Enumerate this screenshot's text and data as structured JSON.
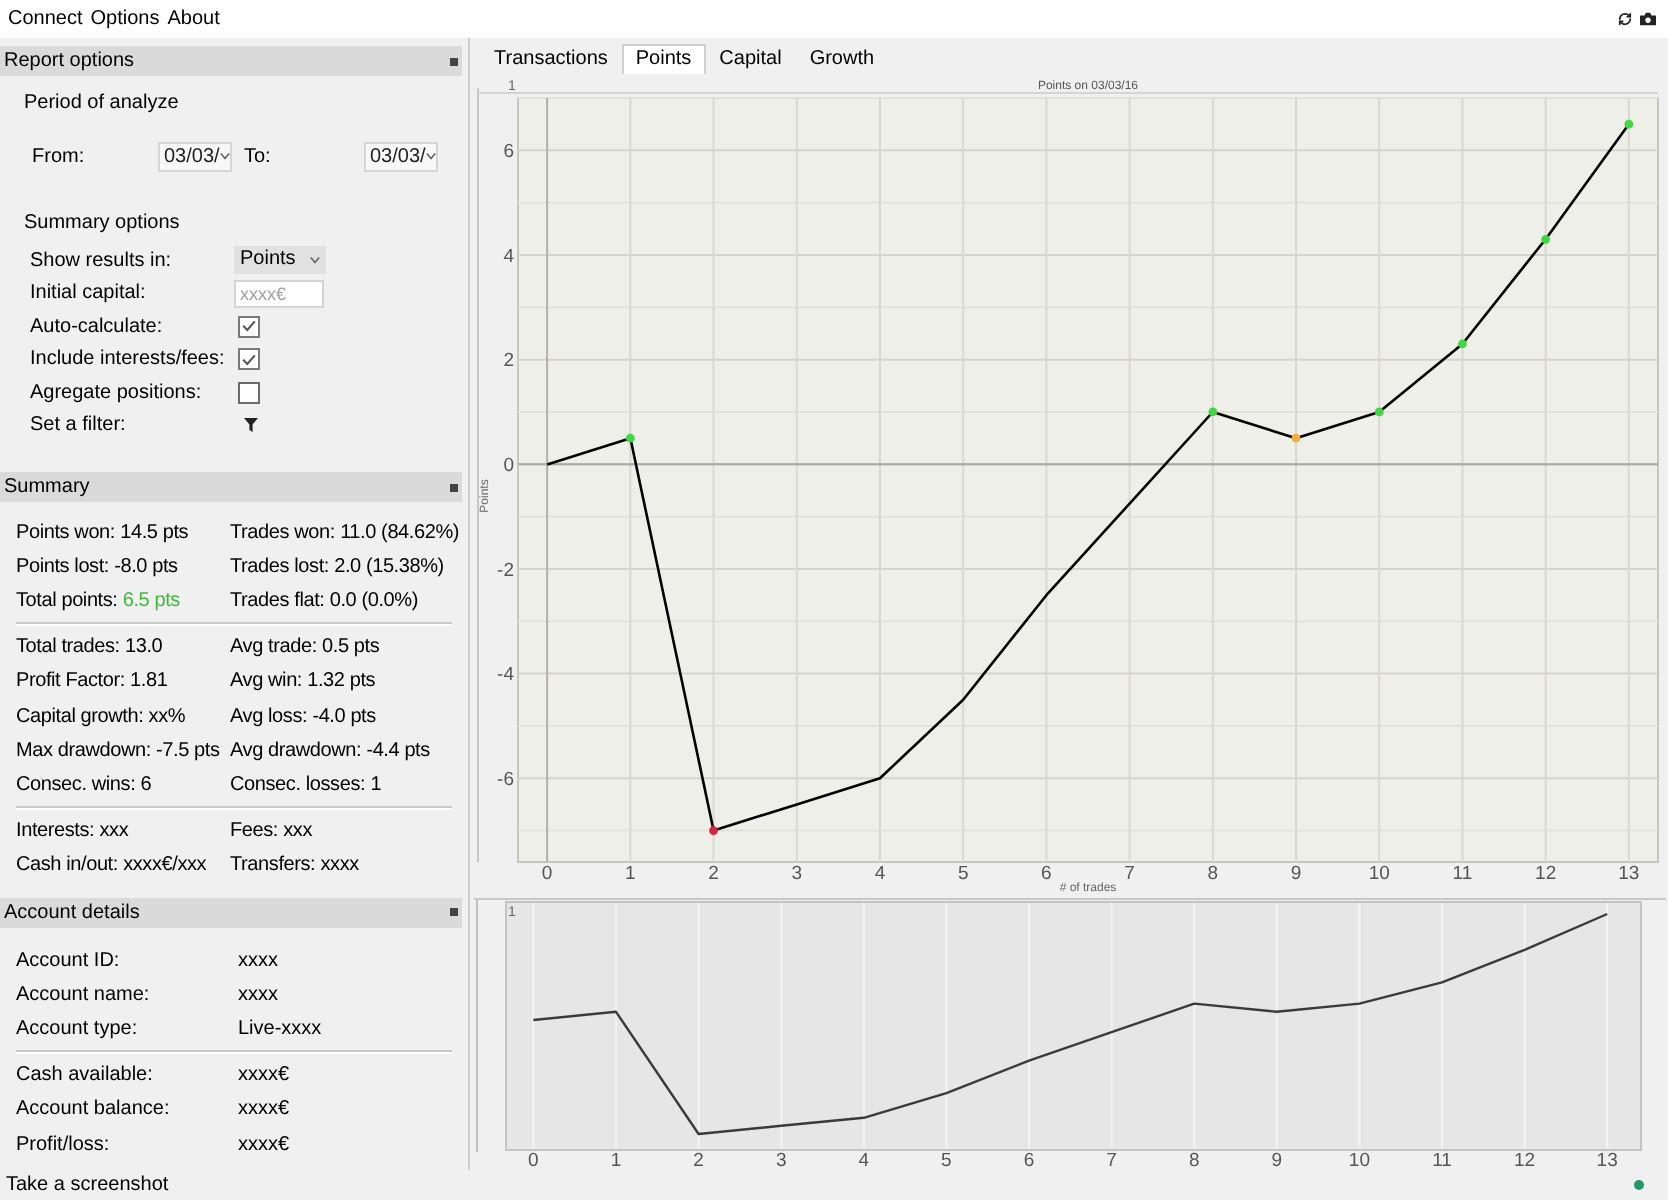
{
  "menu": [
    "Connect",
    "Options",
    "About"
  ],
  "report_options": {
    "title": "Report options",
    "period_heading": "Period of analyze",
    "from_label": "From:",
    "from_value": "03/03/",
    "to_label": "To:",
    "to_value": "03/03/",
    "summary_heading": "Summary options",
    "options": [
      {
        "kind": "select",
        "label": "Show results in:",
        "value": "Points"
      },
      {
        "kind": "input",
        "label": "Initial capital:",
        "placeholder": "xxxx€"
      },
      {
        "kind": "checkbox",
        "label": "Auto-calculate:",
        "checked": true
      },
      {
        "kind": "checkbox",
        "label": "Include interests/fees:",
        "checked": true
      },
      {
        "kind": "checkbox",
        "label": "Agregate positions:",
        "checked": false
      },
      {
        "kind": "filter",
        "label": "Set a filter:"
      }
    ]
  },
  "summary": {
    "title": "Summary",
    "groups": [
      [
        [
          {
            "label": "Points won:",
            "value": "14.5 pts"
          },
          {
            "label": "Trades won:",
            "value": "11.0 (84.62%)"
          }
        ],
        [
          {
            "label": "Points lost:",
            "value": "-8.0 pts"
          },
          {
            "label": "Trades lost:",
            "value": "2.0 (15.38%)"
          }
        ],
        [
          {
            "label": "Total points:",
            "value": "6.5 pts",
            "color": "#3dbb3d"
          },
          {
            "label": "Trades flat:",
            "value": "0.0 (0.0%)"
          }
        ]
      ],
      [
        [
          {
            "label": "Total trades:",
            "value": "13.0"
          },
          {
            "label": "Avg trade:",
            "value": "0.5 pts"
          }
        ],
        [
          {
            "label": "Profit Factor:",
            "value": "1.81"
          },
          {
            "label": "Avg win:",
            "value": "1.32 pts"
          }
        ],
        [
          {
            "label": "Capital growth:",
            "value": "xx%"
          },
          {
            "label": "Avg loss:",
            "value": "-4.0 pts"
          }
        ],
        [
          {
            "label": "Max drawdown:",
            "value": "-7.5 pts"
          },
          {
            "label": "Avg drawdown:",
            "value": "-4.4 pts"
          }
        ],
        [
          {
            "label": "Consec. wins:",
            "value": "6"
          },
          {
            "label": "Consec. losses:",
            "value": "1"
          }
        ]
      ],
      [
        [
          {
            "label": "Interests:",
            "value": "xxx"
          },
          {
            "label": "Fees:",
            "value": "xxx"
          }
        ],
        [
          {
            "label": "Cash in/out:",
            "value": "xxxx€/xxx"
          },
          {
            "label": "Transfers:",
            "value": "xxxx"
          }
        ]
      ]
    ]
  },
  "account_details": {
    "title": "Account details",
    "groups": [
      [
        {
          "label": "Account ID:",
          "value": "xxxx"
        },
        {
          "label": "Account name:",
          "value": "xxxx"
        },
        {
          "label": "Account type:",
          "value": "Live-xxxx"
        }
      ],
      [
        {
          "label": "Cash available:",
          "value": "xxxx€"
        },
        {
          "label": "Account balance:",
          "value": "xxxx€"
        },
        {
          "label": "Profit/loss:",
          "value": "xxxx€"
        }
      ]
    ]
  },
  "tabs": [
    {
      "label": "Transactions",
      "selected": false
    },
    {
      "label": "Points",
      "selected": true
    },
    {
      "label": "Capital",
      "selected": false
    },
    {
      "label": "Growth",
      "selected": false
    }
  ],
  "chart": {
    "corner_label": "1",
    "chart_data": {
      "type": "line",
      "title": "Points on 03/03/16",
      "xlabel": "# of trades",
      "ylabel": "Points",
      "x": [
        0,
        1,
        2,
        3,
        4,
        5,
        6,
        7,
        8,
        9,
        10,
        11,
        12,
        13
      ],
      "series": [
        {
          "color": "#000000",
          "values": [
            0,
            0.5,
            -7,
            -6.5,
            -6,
            -4.5,
            -2.5,
            -0.75,
            1,
            0.5,
            1,
            2.3,
            4.3,
            6.5
          ]
        },
        {
          "type": "scatter",
          "color": "#40d840",
          "values": [
            null,
            0.5,
            null,
            null,
            null,
            null,
            null,
            null,
            1,
            null,
            1,
            2.3,
            4.3,
            6.5
          ]
        },
        {
          "type": "scatter",
          "color": "#e02040",
          "values": [
            null,
            null,
            -7,
            null,
            null,
            null,
            null,
            null,
            null,
            null,
            null,
            null,
            null,
            null
          ]
        },
        {
          "type": "scatter",
          "color": "#f0b040",
          "values": [
            null,
            null,
            null,
            null,
            null,
            null,
            null,
            null,
            null,
            0.5,
            null,
            null,
            null,
            null
          ]
        }
      ],
      "xlim": [
        -0.35,
        13.35
      ],
      "ylim": [
        -7.6,
        7
      ],
      "xticks": [
        0,
        1,
        2,
        3,
        4,
        5,
        6,
        7,
        8,
        9,
        10,
        11,
        12,
        13
      ],
      "yticks": [
        -6,
        -4,
        -2,
        0,
        2,
        4,
        6
      ],
      "grid": true
    }
  },
  "overview": {
    "corner_label": "1",
    "xticks": [
      "0",
      "1",
      "2",
      "3",
      "4",
      "5",
      "6",
      "7",
      "8",
      "9",
      "10",
      "11",
      "12",
      "13"
    ]
  },
  "status_bar": {
    "message": "Take a screenshot",
    "connected": true
  }
}
